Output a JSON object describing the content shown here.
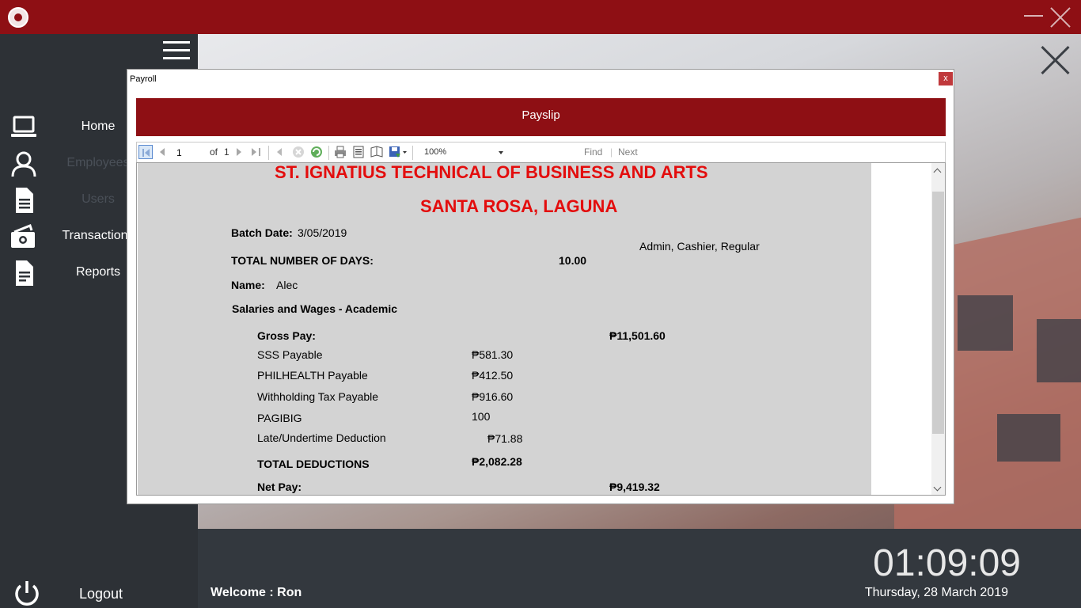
{
  "titlebar": {
    "logo": "school-seal-logo",
    "minimize_icon": "minimize-icon",
    "close_icon": "close-icon"
  },
  "sidebar": {
    "menu_icon": "hamburger-menu-icon",
    "items": [
      {
        "label": "Home",
        "icon": "laptop-icon"
      },
      {
        "label": "Employees",
        "icon": "user-icon"
      },
      {
        "label": "Users",
        "icon": "document-icon"
      },
      {
        "label": "Transactions",
        "icon": "cash-icon"
      },
      {
        "label": "Reports",
        "icon": "report-icon"
      }
    ],
    "logout_label": "Logout",
    "logout_icon": "power-icon"
  },
  "statusbar": {
    "welcome_prefix": "Welcome : ",
    "user_name": "Ron",
    "clock": "01:09:09",
    "date": "Thursday, 28 March 2019"
  },
  "dialog": {
    "title": "Payroll",
    "close_label": "x",
    "header": "Payslip",
    "toolbar": {
      "page_value": "1",
      "of_label": "of",
      "total_pages": "1",
      "zoom": "100%",
      "find_label": "Find",
      "separator": "|",
      "next_label": "Next"
    }
  },
  "payslip": {
    "school_name": "ST. IGNATIUS TECHNICAL OF BUSINESS AND ARTS",
    "location": "SANTA ROSA, LAGUNA",
    "batch_date_label": "Batch Date:",
    "batch_date": "3/05/2019",
    "roles": "Admin, Cashier, Regular",
    "days_label": "TOTAL NUMBER OF DAYS:",
    "days_value": "10.00",
    "name_label": "Name:",
    "name_value": "Alec",
    "category": "Salaries and Wages - Academic",
    "gross_label": "Gross Pay:",
    "gross_value": "₱11,501.60",
    "deductions": [
      {
        "label": "SSS Payable",
        "value": "₱581.30"
      },
      {
        "label": "PHILHEALTH Payable",
        "value": "₱412.50"
      },
      {
        "label": "Withholding Tax Payable",
        "value": "₱916.60"
      },
      {
        "label": "PAGIBIG",
        "value": "100"
      },
      {
        "label": "Late/Undertime Deduction",
        "value": "₱71.88"
      }
    ],
    "total_deductions_label": "TOTAL DEDUCTIONS",
    "total_deductions_value": "₱2,082.28",
    "net_label": "Net Pay:",
    "net_value": "₱9,419.32"
  }
}
